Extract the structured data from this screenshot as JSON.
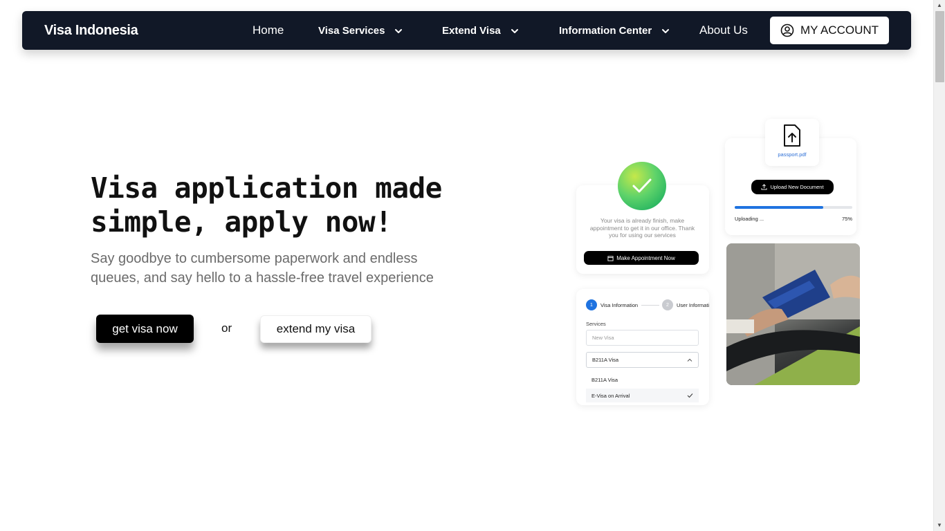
{
  "nav": {
    "brand": "Visa Indonesia",
    "items": [
      {
        "label": "Home",
        "has_dropdown": false
      },
      {
        "label": "Visa Services",
        "has_dropdown": true
      },
      {
        "label": "Extend Visa",
        "has_dropdown": true
      },
      {
        "label": "Information Center",
        "has_dropdown": true
      },
      {
        "label": "About Us",
        "has_dropdown": false
      }
    ],
    "account_label": "MY ACCOUNT",
    "account_icon": "user-circle-icon"
  },
  "hero": {
    "title": "Visa application made simple, apply now!",
    "subtitle": "Say goodbye to cumbersome paperwork and endless queues, and say hello to a hassle-free travel experience",
    "primary_cta": "get visa now",
    "or_text": "or",
    "secondary_cta": "extend my visa"
  },
  "illustration": {
    "success_card": {
      "message": "Your visa is already finish, make appointment to get it in our office. Thank you for using our services",
      "button": "Make Appointment Now",
      "icon": "check-icon"
    },
    "upload_card": {
      "file_name": "passport.pdf",
      "button": "Upload New Document",
      "status": "Uploading ...",
      "percent_label": "75%",
      "progress_fraction": 0.75
    },
    "form_card": {
      "step1_num": "1",
      "step1_label": "Visa Information",
      "step2_num": "2",
      "step2_label": "User Information",
      "services_label": "Services",
      "services_placeholder": "New Visa",
      "selected_visa": "B211A Visa",
      "options": [
        "B211A Visa",
        "E-Visa on Arrival"
      ]
    }
  },
  "colors": {
    "nav_bg": "#111827",
    "accent_blue": "#1f73e0",
    "primary_button": "#000000"
  }
}
